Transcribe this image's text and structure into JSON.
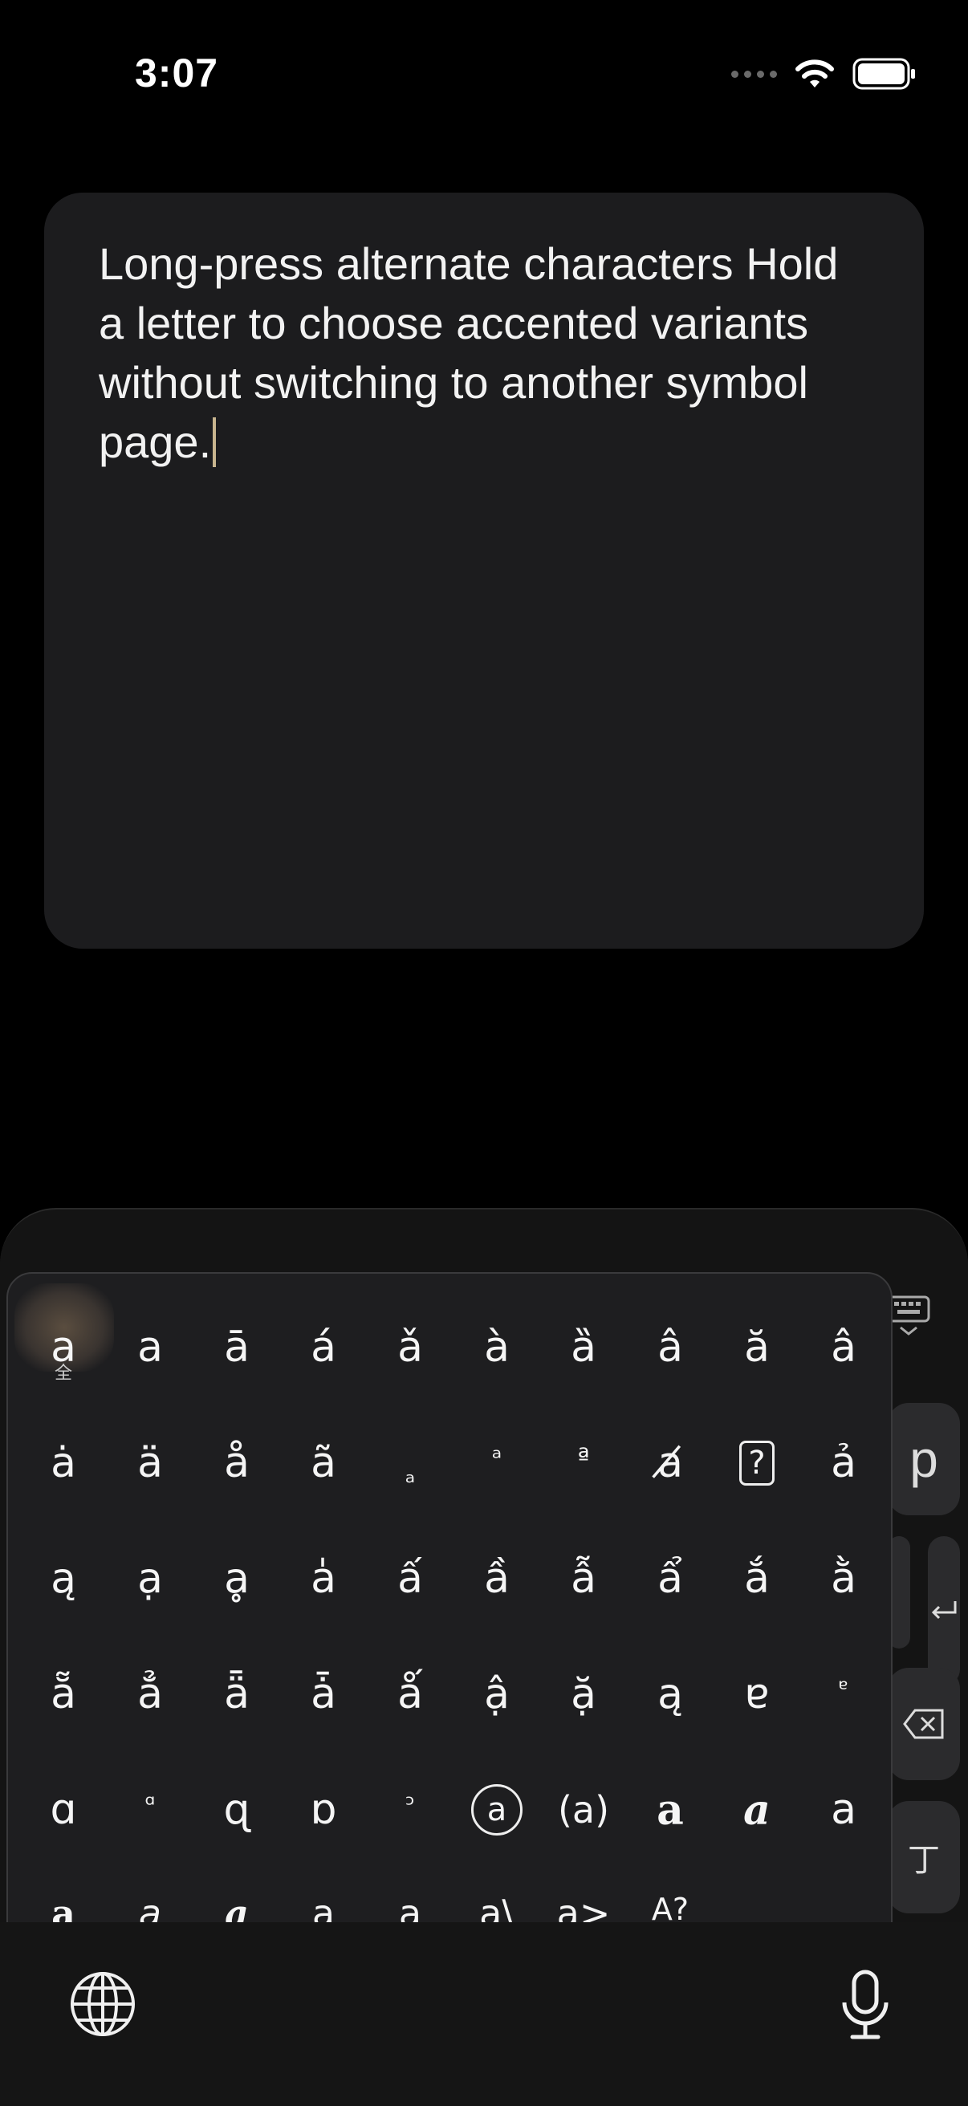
{
  "status": {
    "time": "3:07"
  },
  "note": {
    "text": "Long-press alternate characters Hold a letter to choose accented variants without switching to another symbol page."
  },
  "keyboard": {
    "side_key_p": "p",
    "side_key_cjk": "丁",
    "popup_rows": [
      [
        "a",
        "a",
        "ā",
        "á",
        "ǎ",
        "à",
        "ȁ",
        "â",
        "ă",
        "â"
      ],
      [
        "ȧ",
        "ä",
        "å",
        "ã",
        "ₐ",
        "ᵃ",
        "ª",
        "a̸",
        "?",
        "ả"
      ],
      [
        "ą",
        "ạ",
        "ḁ",
        "a̍",
        "ấ",
        "ầ",
        "ẫ",
        "ẩ",
        "ắ",
        "ằ"
      ],
      [
        "ẵ",
        "ẳ",
        "ǟ",
        "ǡ",
        "ǻ",
        "ậ",
        "ặ",
        "ą",
        "ɐ",
        "ᵄ"
      ],
      [
        "ɑ",
        "ᵅ",
        "ɋ",
        "ɒ",
        "ᵓ",
        "a",
        "(a)",
        "a",
        "a",
        "a"
      ],
      [
        "a",
        "a",
        "a",
        "a",
        "a",
        "a\\",
        "a>",
        "A?",
        "",
        ""
      ]
    ],
    "first_cell_sub": "全"
  }
}
